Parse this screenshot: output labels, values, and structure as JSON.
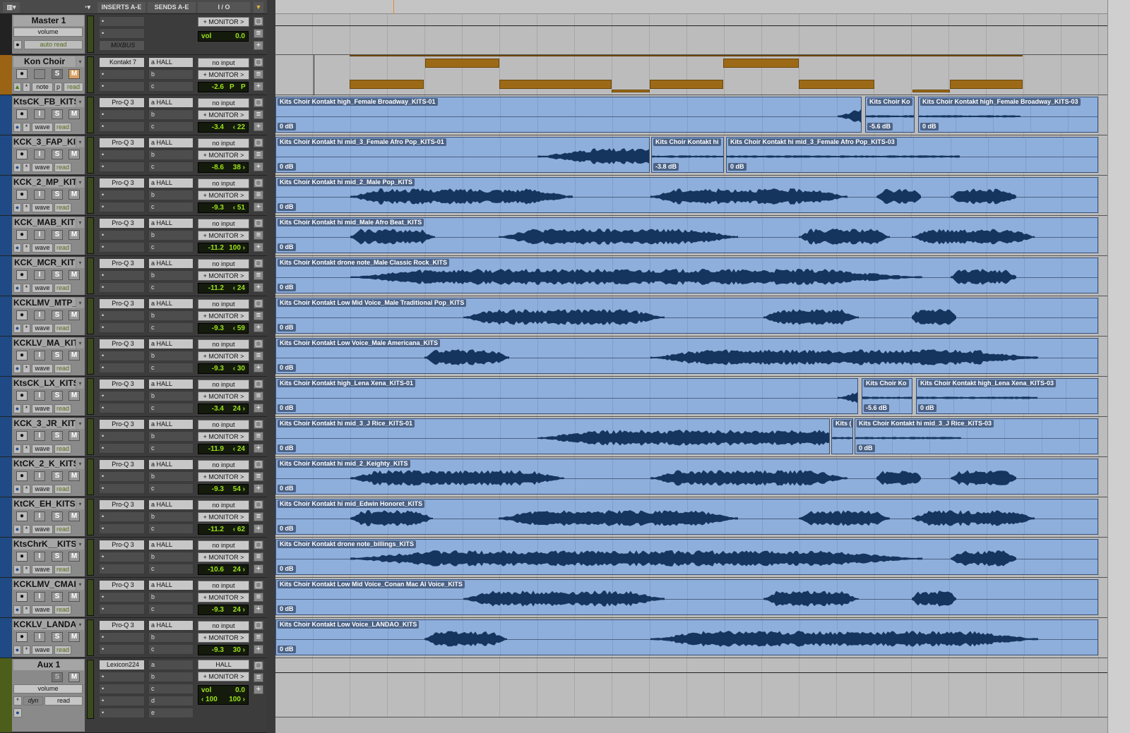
{
  "header": {
    "columns": [
      "INSERTS A-E",
      "SENDS A-E",
      "I / O"
    ]
  },
  "colors": {
    "track_strip": "#1f4a85",
    "instrument_strip": "#9a6414",
    "master_strip": "#222222",
    "aux_strip": "#4c5e1a",
    "clip": "#8eaedb",
    "waveform": "#16355e",
    "midi_note": "#9c6a17",
    "lcd_text": "#9be21a"
  },
  "master": {
    "name": "Master 1",
    "view": "volume",
    "automation": "auto read",
    "insert": "MIXBUS",
    "output": "+ MONITOR >",
    "lcd_left": "vol",
    "lcd_right": "0.0"
  },
  "instrument": {
    "name": "Kon Choir",
    "insert": "Kontakt 7",
    "send_a": "HALL",
    "input": "no input",
    "output": "+ MONITOR >",
    "vol": "-2.6",
    "pan_l": "P",
    "pan_r": "P",
    "view": "note",
    "p": "p",
    "auto": "read"
  },
  "tracks": [
    {
      "name": "KtsCK_FB_KITS",
      "vol": "-3.4",
      "pan": "‹ 22",
      "clips": [
        {
          "name": "Kits Choir Kontakt high_Female Broadway_KITS-01",
          "gain": "0 dB"
        },
        {
          "name": "Kits Choir Ko",
          "gain": "-5.6 dB"
        },
        {
          "name": "Kits Choir Kontakt high_Female Broadway_KITS-03",
          "gain": "0 dB"
        }
      ]
    },
    {
      "name": "KCK_3_FAP_KI",
      "vol": "-8.6",
      "pan": "38 ›",
      "clips": [
        {
          "name": "Kits Choir Kontakt hi mid_3_Female Afro Pop_KITS-01",
          "gain": "0 dB"
        },
        {
          "name": "Kits Choir Kontakt hi",
          "gain": "-3.8 dB"
        },
        {
          "name": "Kits Choir Kontakt hi mid_3_Female Afro Pop_KITS-03",
          "gain": "0 dB"
        }
      ]
    },
    {
      "name": "KCK_2_MP_KIT",
      "vol": "-9.3",
      "pan": "‹ 51",
      "clips": [
        {
          "name": "Kits Choir Kontakt hi mid_2_Male Pop_KITS",
          "gain": "0 dB"
        }
      ]
    },
    {
      "name": "KCK_MAB_KIT",
      "vol": "-11.2",
      "pan": "100 ›",
      "clips": [
        {
          "name": "Kits Choir Kontakt hi mid_Male Afro Beat_KITS",
          "gain": "0 dB"
        }
      ]
    },
    {
      "name": "KCK_MCR_KIT",
      "vol": "-11.2",
      "pan": "‹ 24",
      "clips": [
        {
          "name": "Kits Choir Kontakt drone note_Male Classic Rock_KITS",
          "gain": "0 dB"
        }
      ]
    },
    {
      "name": "KCKLMV_MTP_",
      "vol": "-9.3",
      "pan": "‹ 59",
      "clips": [
        {
          "name": "Kits Choir Kontakt Low Mid Voice_Male Traditional Pop_KITS",
          "gain": "0 dB"
        }
      ]
    },
    {
      "name": "KCKLV_MA_KIT",
      "vol": "-9.3",
      "pan": "‹ 30",
      "clips": [
        {
          "name": "Kits Choir Kontakt Low Voice_Male Americana_KITS",
          "gain": "0 dB"
        }
      ]
    },
    {
      "name": "KtsCK_LX_KITS",
      "vol": "-3.4",
      "pan": "24 ›",
      "clips": [
        {
          "name": "Kits Choir Kontakt high_Lena Xena_KITS-01",
          "gain": "0 dB"
        },
        {
          "name": "Kits Choir Ko",
          "gain": "-5.6 dB"
        },
        {
          "name": "Kits Choir Kontakt high_Lena Xena_KITS-03",
          "gain": "0 dB"
        }
      ]
    },
    {
      "name": "KCK_3_JR_KIT",
      "vol": "-11.9",
      "pan": "‹ 24",
      "clips": [
        {
          "name": "Kits Choir Kontakt hi mid_3_J Rice_KITS-01",
          "gain": "0 dB"
        },
        {
          "name": "Kits (",
          "gain": ""
        },
        {
          "name": "Kits Choir Kontakt hi mid_3_J Rice_KITS-03",
          "gain": "0 dB"
        }
      ]
    },
    {
      "name": "KtCK_2_K_KITS",
      "vol": "-9.3",
      "pan": "54 ›",
      "clips": [
        {
          "name": "Kits Choir Kontakt hi mid_2_Keighty_KITS",
          "gain": "0 dB"
        }
      ]
    },
    {
      "name": "KtCK_EH_KITS",
      "vol": "-11.2",
      "pan": "‹ 62",
      "clips": [
        {
          "name": "Kits Choir Kontakt hi mid_Edwin Honoret_KITS",
          "gain": "0 dB"
        }
      ]
    },
    {
      "name": "KtsChrK__KITS",
      "vol": "-10.6",
      "pan": "24 ›",
      "clips": [
        {
          "name": "Kits Choir Kontakt drone note_billings_KITS",
          "gain": "0 dB"
        }
      ]
    },
    {
      "name": "KCKLMV_CMAI",
      "vol": "-9.3",
      "pan": "24 ›",
      "clips": [
        {
          "name": "Kits Choir Kontakt Low Mid Voice_Conan Mac Al Voice_KITS",
          "gain": "0 dB"
        }
      ]
    },
    {
      "name": "KCKLV_LANDA",
      "vol": "-9.3",
      "pan": "30 ›",
      "clips": [
        {
          "name": "Kits Choir Kontakt Low Voice_LANDAO_KITS",
          "gain": "0 dB"
        }
      ]
    }
  ],
  "track_common": {
    "insert": "Pro-Q 3",
    "send_a": "HALL",
    "sends": [
      "a",
      "b",
      "c"
    ],
    "input": "no input",
    "output": "+ MONITOR >",
    "view": "wave",
    "auto": "read",
    "rec": "",
    "input_btn": "I",
    "solo": "S",
    "mute": "M"
  },
  "aux": {
    "name": "Aux 1",
    "insert": "Lexicon224",
    "sends": [
      "a",
      "b",
      "c",
      "d",
      "e"
    ],
    "input": "HALL",
    "output": "+ MONITOR >",
    "lcd_left": "vol",
    "lcd_right": "0.0",
    "pan_l": "‹ 100",
    "pan_r": "100 ›",
    "view": "volume",
    "dyn": "dyn",
    "auto": "read",
    "solo": "S",
    "mute": "M"
  }
}
